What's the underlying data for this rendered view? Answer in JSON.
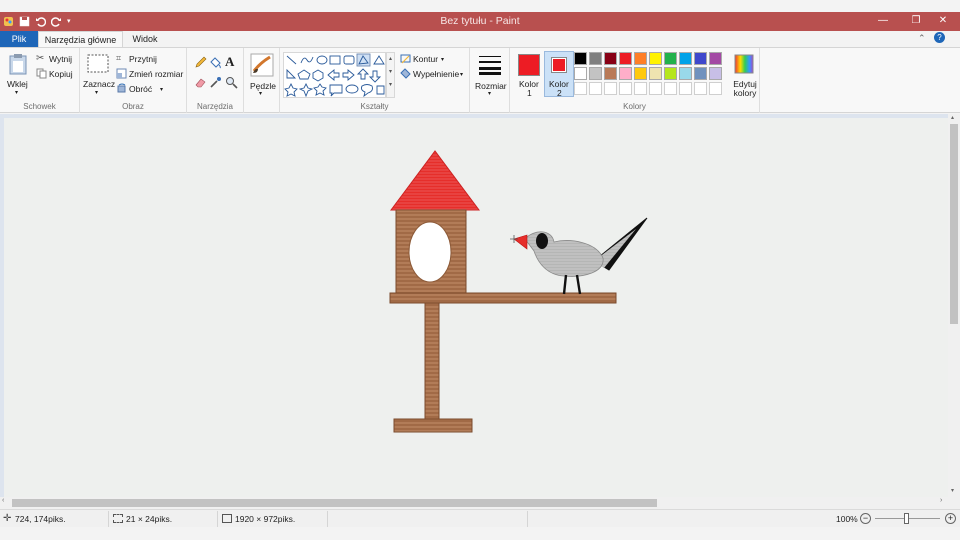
{
  "window": {
    "title": "Bez tytułu - Paint",
    "accent": "#b8504f"
  },
  "tabs": [
    {
      "label": "Plik"
    },
    {
      "label": "Narzędzia główne"
    },
    {
      "label": "Widok"
    }
  ],
  "ribbon": {
    "clipboard": {
      "group_label": "Schowek",
      "paste": "Wklej",
      "cut": "Wytnij",
      "copy": "Kopiuj"
    },
    "image": {
      "group_label": "Obraz",
      "select": "Zaznacz",
      "crop": "Przytnij",
      "resize": "Zmień rozmiar",
      "rotate": "Obróć"
    },
    "tools": {
      "group_label": "Narzędzia",
      "text_tool_glyph": "A"
    },
    "brushes": {
      "label": "Pędzle"
    },
    "shapes": {
      "group_label": "Kształty",
      "outline": "Kontur",
      "fill": "Wypełnienie"
    },
    "size": {
      "label": "Rozmiar"
    },
    "colors": {
      "group_label": "Kolory",
      "color1_label": "Kolor",
      "color1_num": "1",
      "color2_label": "Kolor",
      "color2_num": "2",
      "color1": "#ed1c24",
      "color2": "#ed1c24",
      "edit": "Edytuj kolory",
      "palette_row1": [
        "#000000",
        "#7f7f7f",
        "#880015",
        "#ed1c24",
        "#ff7f27",
        "#fff200",
        "#22b14c",
        "#00a2e8",
        "#3f48cc",
        "#a349a4"
      ],
      "palette_row2": [
        "#ffffff",
        "#c3c3c3",
        "#b97a57",
        "#ffaec9",
        "#ffc90e",
        "#efe4b0",
        "#b5e61d",
        "#99d9ea",
        "#7092be",
        "#c8bfe7"
      ]
    }
  },
  "status": {
    "cursor_pos": "724, 174piks.",
    "selection_size": "21 × 24piks.",
    "image_size": "1920 × 972piks.",
    "zoom": "100%"
  }
}
